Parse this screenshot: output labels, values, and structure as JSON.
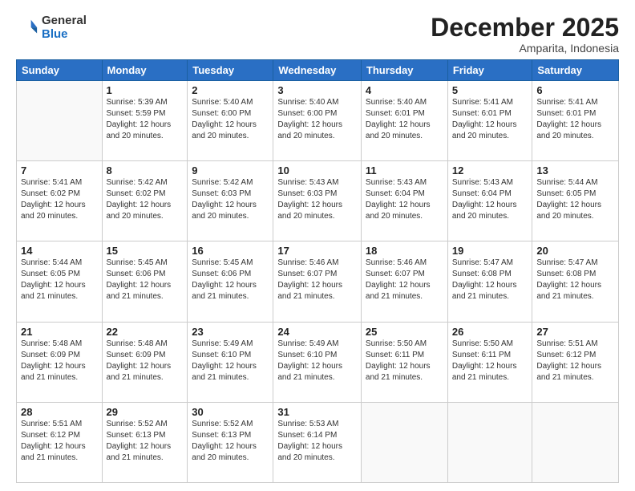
{
  "header": {
    "logo_line1": "General",
    "logo_line2": "Blue",
    "month_year": "December 2025",
    "location": "Amparita, Indonesia"
  },
  "weekdays": [
    "Sunday",
    "Monday",
    "Tuesday",
    "Wednesday",
    "Thursday",
    "Friday",
    "Saturday"
  ],
  "weeks": [
    [
      {
        "day": "",
        "info": ""
      },
      {
        "day": "1",
        "info": "Sunrise: 5:39 AM\nSunset: 5:59 PM\nDaylight: 12 hours\nand 20 minutes."
      },
      {
        "day": "2",
        "info": "Sunrise: 5:40 AM\nSunset: 6:00 PM\nDaylight: 12 hours\nand 20 minutes."
      },
      {
        "day": "3",
        "info": "Sunrise: 5:40 AM\nSunset: 6:00 PM\nDaylight: 12 hours\nand 20 minutes."
      },
      {
        "day": "4",
        "info": "Sunrise: 5:40 AM\nSunset: 6:01 PM\nDaylight: 12 hours\nand 20 minutes."
      },
      {
        "day": "5",
        "info": "Sunrise: 5:41 AM\nSunset: 6:01 PM\nDaylight: 12 hours\nand 20 minutes."
      },
      {
        "day": "6",
        "info": "Sunrise: 5:41 AM\nSunset: 6:01 PM\nDaylight: 12 hours\nand 20 minutes."
      }
    ],
    [
      {
        "day": "7",
        "info": ""
      },
      {
        "day": "8",
        "info": "Sunrise: 5:42 AM\nSunset: 6:02 PM\nDaylight: 12 hours\nand 20 minutes."
      },
      {
        "day": "9",
        "info": "Sunrise: 5:42 AM\nSunset: 6:03 PM\nDaylight: 12 hours\nand 20 minutes."
      },
      {
        "day": "10",
        "info": "Sunrise: 5:43 AM\nSunset: 6:03 PM\nDaylight: 12 hours\nand 20 minutes."
      },
      {
        "day": "11",
        "info": "Sunrise: 5:43 AM\nSunset: 6:04 PM\nDaylight: 12 hours\nand 20 minutes."
      },
      {
        "day": "12",
        "info": "Sunrise: 5:43 AM\nSunset: 6:04 PM\nDaylight: 12 hours\nand 20 minutes."
      },
      {
        "day": "13",
        "info": "Sunrise: 5:44 AM\nSunset: 6:05 PM\nDaylight: 12 hours\nand 20 minutes."
      }
    ],
    [
      {
        "day": "14",
        "info": ""
      },
      {
        "day": "15",
        "info": "Sunrise: 5:45 AM\nSunset: 6:06 PM\nDaylight: 12 hours\nand 21 minutes."
      },
      {
        "day": "16",
        "info": "Sunrise: 5:45 AM\nSunset: 6:06 PM\nDaylight: 12 hours\nand 21 minutes."
      },
      {
        "day": "17",
        "info": "Sunrise: 5:46 AM\nSunset: 6:07 PM\nDaylight: 12 hours\nand 21 minutes."
      },
      {
        "day": "18",
        "info": "Sunrise: 5:46 AM\nSunset: 6:07 PM\nDaylight: 12 hours\nand 21 minutes."
      },
      {
        "day": "19",
        "info": "Sunrise: 5:47 AM\nSunset: 6:08 PM\nDaylight: 12 hours\nand 21 minutes."
      },
      {
        "day": "20",
        "info": "Sunrise: 5:47 AM\nSunset: 6:08 PM\nDaylight: 12 hours\nand 21 minutes."
      }
    ],
    [
      {
        "day": "21",
        "info": ""
      },
      {
        "day": "22",
        "info": "Sunrise: 5:48 AM\nSunset: 6:09 PM\nDaylight: 12 hours\nand 21 minutes."
      },
      {
        "day": "23",
        "info": "Sunrise: 5:49 AM\nSunset: 6:10 PM\nDaylight: 12 hours\nand 21 minutes."
      },
      {
        "day": "24",
        "info": "Sunrise: 5:49 AM\nSunset: 6:10 PM\nDaylight: 12 hours\nand 21 minutes."
      },
      {
        "day": "25",
        "info": "Sunrise: 5:50 AM\nSunset: 6:11 PM\nDaylight: 12 hours\nand 21 minutes."
      },
      {
        "day": "26",
        "info": "Sunrise: 5:50 AM\nSunset: 6:11 PM\nDaylight: 12 hours\nand 21 minutes."
      },
      {
        "day": "27",
        "info": "Sunrise: 5:51 AM\nSunset: 6:12 PM\nDaylight: 12 hours\nand 21 minutes."
      }
    ],
    [
      {
        "day": "28",
        "info": "Sunrise: 5:51 AM\nSunset: 6:12 PM\nDaylight: 12 hours\nand 21 minutes."
      },
      {
        "day": "29",
        "info": "Sunrise: 5:52 AM\nSunset: 6:13 PM\nDaylight: 12 hours\nand 21 minutes."
      },
      {
        "day": "30",
        "info": "Sunrise: 5:52 AM\nSunset: 6:13 PM\nDaylight: 12 hours\nand 20 minutes."
      },
      {
        "day": "31",
        "info": "Sunrise: 5:53 AM\nSunset: 6:14 PM\nDaylight: 12 hours\nand 20 minutes."
      },
      {
        "day": "",
        "info": ""
      },
      {
        "day": "",
        "info": ""
      },
      {
        "day": "",
        "info": ""
      }
    ]
  ],
  "day14_info": "Sunrise: 5:44 AM\nSunset: 6:05 PM\nDaylight: 12 hours\nand 21 minutes.",
  "day7_info": "Sunrise: 5:41 AM\nSunset: 6:02 PM\nDaylight: 12 hours\nand 20 minutes.",
  "day21_info": "Sunrise: 5:48 AM\nSunset: 6:09 PM\nDaylight: 12 hours\nand 21 minutes."
}
